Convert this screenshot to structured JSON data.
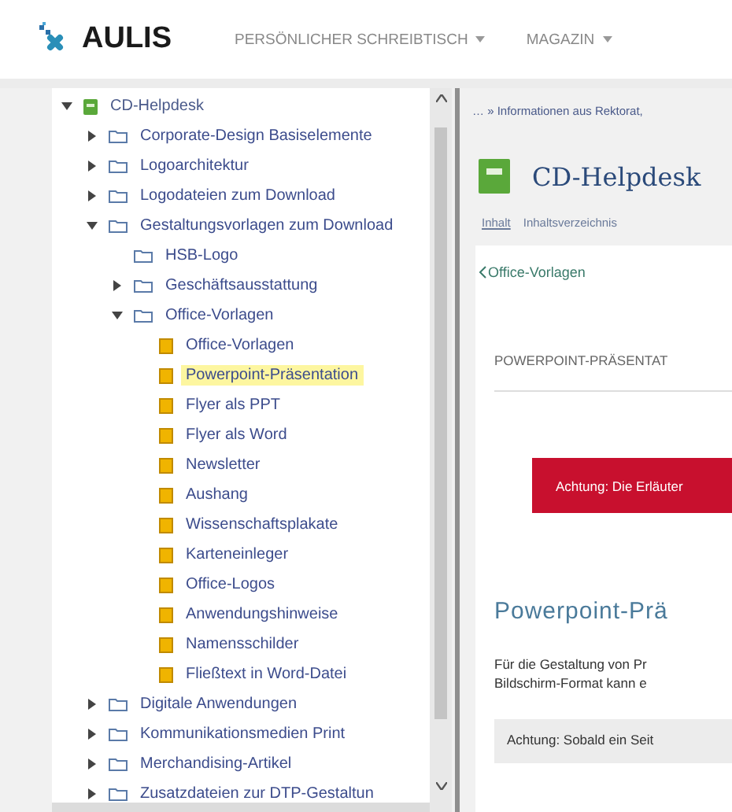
{
  "header": {
    "logo": "AULIS",
    "nav": [
      {
        "label": "PERSÖNLICHER SCHREIBTISCH"
      },
      {
        "label": "MAGAZIN"
      }
    ]
  },
  "tree": [
    {
      "label": "CD-Helpdesk",
      "kind": "root",
      "expanded": true,
      "selected": false,
      "children": [
        {
          "label": "Corporate-Design Basiselemente",
          "kind": "folder",
          "expanded": false,
          "selected": false
        },
        {
          "label": "Logoarchitektur",
          "kind": "folder",
          "expanded": false,
          "selected": false
        },
        {
          "label": "Logodateien zum Download",
          "kind": "folder",
          "expanded": false,
          "selected": false
        },
        {
          "label": "Gestaltungsvorlagen zum Download",
          "kind": "folder",
          "expanded": true,
          "selected": false,
          "children": [
            {
              "label": "HSB-Logo",
              "kind": "folder",
              "selected": false
            },
            {
              "label": "Geschäftsausstattung",
              "kind": "folder",
              "expanded": false,
              "selected": false
            },
            {
              "label": "Office-Vorlagen",
              "kind": "folder",
              "expanded": true,
              "selected": false,
              "children": [
                {
                  "label": "Office-Vorlagen",
                  "kind": "page",
                  "selected": false
                },
                {
                  "label": "Powerpoint-Präsentation",
                  "kind": "page",
                  "selected": true
                },
                {
                  "label": "Flyer als PPT",
                  "kind": "page",
                  "selected": false
                },
                {
                  "label": "Flyer als Word",
                  "kind": "page",
                  "selected": false
                },
                {
                  "label": "Newsletter",
                  "kind": "page",
                  "selected": false
                },
                {
                  "label": "Aushang",
                  "kind": "page",
                  "selected": false
                },
                {
                  "label": "Wissenschaftsplakate",
                  "kind": "page",
                  "selected": false
                },
                {
                  "label": "Karteneinleger",
                  "kind": "page",
                  "selected": false
                },
                {
                  "label": "Office-Logos",
                  "kind": "page",
                  "selected": false
                },
                {
                  "label": "Anwendungshinweise",
                  "kind": "page",
                  "selected": false
                },
                {
                  "label": "Namensschilder",
                  "kind": "page",
                  "selected": false
                },
                {
                  "label": "Fließtext in Word-Datei",
                  "kind": "page",
                  "selected": false
                }
              ]
            }
          ]
        },
        {
          "label": "Digitale Anwendungen",
          "kind": "folder",
          "expanded": false,
          "selected": false
        },
        {
          "label": "Kommunikationsmedien Print",
          "kind": "folder",
          "expanded": false,
          "selected": false
        },
        {
          "label": "Merchandising-Artikel",
          "kind": "folder",
          "expanded": false,
          "selected": false
        },
        {
          "label": "Zusatzdateien zur DTP-Gestaltun",
          "kind": "folder",
          "expanded": false,
          "selected": false
        }
      ]
    }
  ],
  "content": {
    "breadcrumb": "… » Informationen aus Rektorat,",
    "title": "CD-Helpdesk",
    "tabs": [
      {
        "label": "Inhalt",
        "selected": true
      },
      {
        "label": "Inhaltsverzeichnis",
        "selected": false
      }
    ],
    "back_link": "Office-Vorlagen",
    "section": "POWERPOINT-PRÄSENTAT",
    "alert": "Achtung: Die Erläuter",
    "heading": "Powerpoint-Prä",
    "paragraph": [
      "Für die Gestaltung von Pr",
      "Bildschirm-Format kann e"
    ],
    "note": "Achtung: Sobald ein Seit"
  }
}
